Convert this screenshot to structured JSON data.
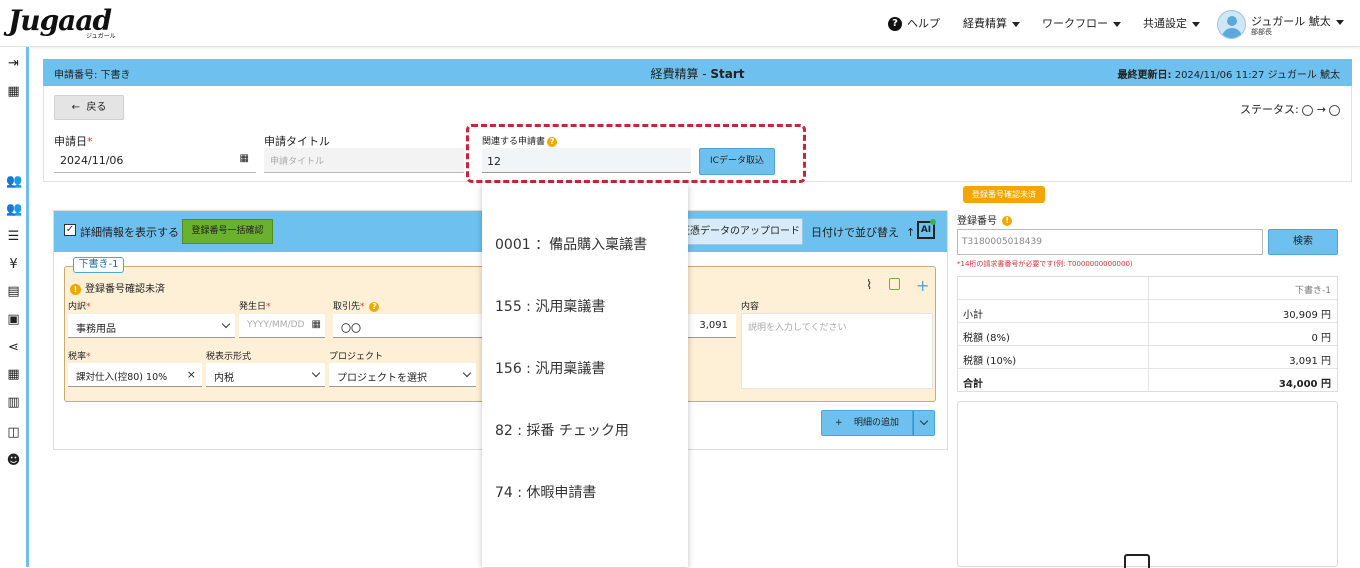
{
  "header": {
    "logo": "Jugaad",
    "logo_sub": "ジュガール",
    "help_label": "ヘルプ",
    "nav": [
      "経費精算",
      "ワークフロー",
      "共通設定"
    ],
    "user_name": "ジュガール 鯱太",
    "user_role": "部部長"
  },
  "sidebar": {
    "icons": [
      "collapse-icon",
      "building-icon",
      "users-icon",
      "users-group-icon",
      "list-icon",
      "yen-icon",
      "document-icon",
      "receipt-icon",
      "share-icon",
      "table-icon",
      "book-stack-icon",
      "open-book-icon",
      "support-icon"
    ]
  },
  "page_header": {
    "left": "申請番号: 下書き",
    "title_prefix": "経費精算 - ",
    "title_bold": "Start",
    "right_label": "最終更新日:",
    "right_value": "2024/11/06 11:27 ジュガール 鯱太"
  },
  "form": {
    "back_label": "戻る",
    "status_label": "ステータス:",
    "date_label": "申請日",
    "date_value": "2024/11/06",
    "title_label": "申請タイトル",
    "title_placeholder": "申請タイトル",
    "related_label": "関連する申請書",
    "related_value": "12",
    "ic_button": "ICデータ取込"
  },
  "dropdown": {
    "items": [
      "0001 ：備品購入稟議書",
      "155 : 汎用稟議書",
      "156 : 汎用稟議書",
      "82 : 採番 チェック用",
      "74 : 休暇申請書"
    ]
  },
  "detail": {
    "show_details_label": "詳細情報を表示する",
    "bulk_check_button": "登録番号一括確認",
    "upload_button": "証憑データのアップロード",
    "sort_label": "日付けで並び替え",
    "ai_label": "AI",
    "draft_tag": "下書き-1",
    "warning_text": "登録番号確認未済",
    "fields": {
      "category_label": "内訳",
      "category_value": "事務用品",
      "date_label": "発生日",
      "date_placeholder": "YYYY/MM/DD",
      "vendor_label": "取引先",
      "vendor_value": "〇〇",
      "amount_value": "3,091",
      "content_label": "内容",
      "content_placeholder": "説明を入力してください",
      "tax_rate_label": "税率",
      "tax_rate_value": "課対仕入(控80) 10%",
      "tax_display_label": "税表示形式",
      "tax_display_value": "内税",
      "project_label": "プロジェクト",
      "project_value": "プロジェクトを選択"
    },
    "add_button": "明細の追加"
  },
  "registration": {
    "badge": "登録番号確認未済",
    "label": "登録番号",
    "value": "T3180005018439",
    "search_button": "検索",
    "hint": "*14桁の請求書番号が必要です(例: T0000000000000)"
  },
  "summary": {
    "column": "下書き-1",
    "rows": [
      {
        "label": "小計",
        "value": "30,909 円"
      },
      {
        "label": "税額 (8%)",
        "value": "0 円"
      },
      {
        "label": "税額 (10%)",
        "value": "3,091 円"
      },
      {
        "label": "合計",
        "value": "34,000 円"
      }
    ]
  },
  "colors": {
    "accent": "#6ec1ef",
    "highlight_dashed": "#c8243a",
    "green_button": "#6ab12e",
    "warning": "#f4a500",
    "entry_bg": "#fdf0d6"
  }
}
